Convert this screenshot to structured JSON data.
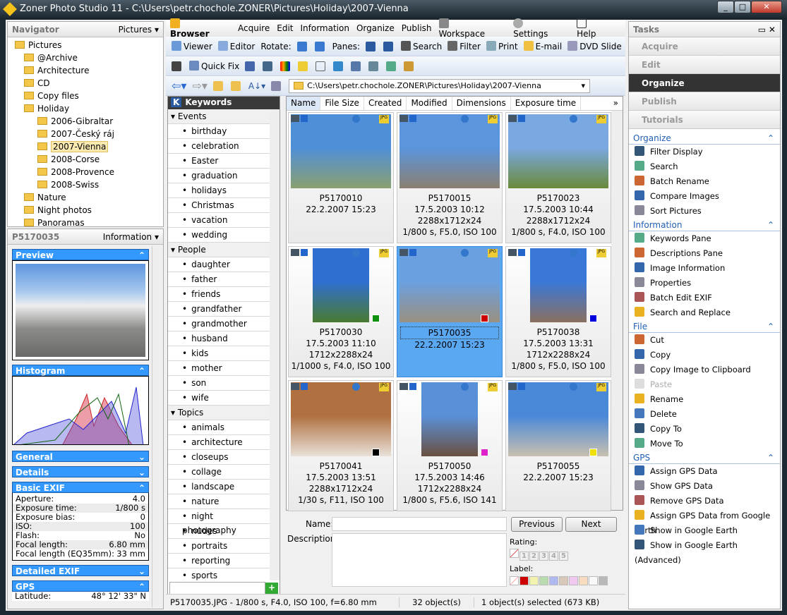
{
  "window": {
    "title": "Zoner Photo Studio 11 - C:\\Users\\petr.chochole.ZONER\\Pictures\\Holiday\\2007-Vienna"
  },
  "navigator": {
    "title": "Navigator",
    "mode": "Pictures",
    "tree": [
      {
        "label": "Pictures",
        "level": 0
      },
      {
        "label": "@Archive",
        "level": 1
      },
      {
        "label": "Architecture",
        "level": 1
      },
      {
        "label": "CD",
        "level": 1
      },
      {
        "label": "Copy files",
        "level": 1
      },
      {
        "label": "Holiday",
        "level": 1
      },
      {
        "label": "2006-Gibraltar",
        "level": 2
      },
      {
        "label": "2007-Český ráj",
        "level": 2
      },
      {
        "label": "2007-Vienna",
        "level": 2,
        "selected": true
      },
      {
        "label": "2008-Corse",
        "level": 2
      },
      {
        "label": "2008-Provence",
        "level": 2
      },
      {
        "label": "2008-Swiss",
        "level": 2
      },
      {
        "label": "Nature",
        "level": 1
      },
      {
        "label": "Night photos",
        "level": 1
      },
      {
        "label": "Panoramas",
        "level": 1
      }
    ]
  },
  "info": {
    "file": "P5170035",
    "mode": "Information",
    "sections": {
      "preview": "Preview",
      "histogram": "Histogram",
      "general": "General",
      "details": "Details",
      "basic_exif": "Basic EXIF",
      "detailed_exif": "Detailed EXIF",
      "gps": "GPS"
    },
    "exif": [
      [
        "Aperture:",
        "4.0"
      ],
      [
        "Exposure time:",
        "1/800 s"
      ],
      [
        "Exposure bias:",
        "0"
      ],
      [
        "ISO:",
        "100"
      ],
      [
        "Flash:",
        "No"
      ],
      [
        "Focal length:",
        "6.80 mm"
      ],
      [
        "Focal length (EQ35mm):",
        "33 mm"
      ]
    ],
    "gps": [
      [
        "Latitude:",
        "48° 12' 33\" N"
      ]
    ]
  },
  "menu": {
    "browser": "Browser",
    "items": [
      "Acquire",
      "Edit",
      "Information",
      "Organize",
      "Publish"
    ],
    "workspace": "Workspace",
    "settings": "Settings",
    "help": "Help"
  },
  "toolbar1": {
    "viewer": "Viewer",
    "editor": "Editor",
    "rotate": "Rotate:",
    "panes": "Panes:",
    "search": "Search",
    "filter": "Filter",
    "print": "Print",
    "email": "E-mail",
    "dvd": "DVD Slide"
  },
  "toolbar2": {
    "quickfix": "Quick Fix"
  },
  "path": "C:\\Users\\petr.chochole.ZONER\\Pictures\\Holiday\\2007-Vienna",
  "keywords": {
    "title": "Keywords",
    "groups": [
      {
        "name": "Events",
        "items": [
          "birthday",
          "celebration",
          "Easter",
          "graduation",
          "holidays",
          "Christmas",
          "vacation",
          "wedding"
        ]
      },
      {
        "name": "People",
        "items": [
          "daughter",
          "father",
          "friends",
          "grandfather",
          "grandmother",
          "husband",
          "kids",
          "mother",
          "son",
          "wife"
        ]
      },
      {
        "name": "Topics",
        "items": [
          "animals",
          "architecture",
          "closeups",
          "collage",
          "landscape",
          "nature",
          "night photography",
          "nudes",
          "portraits",
          "reporting",
          "sports"
        ]
      }
    ]
  },
  "columns": [
    "Name",
    "File Size",
    "Created",
    "Modified",
    "Dimensions",
    "Exposure time"
  ],
  "thumbs": [
    {
      "name": "P5170010",
      "l2": "22.2.2007 15:23",
      "l3": "",
      "l4": "",
      "c1": "#4f8fd8",
      "c2": "#8aa070"
    },
    {
      "name": "P5170015",
      "l2": "17.5.2003 10:12",
      "l3": "2288x1712x24",
      "l4": "1/800 s, F5.0, ISO 100",
      "c1": "#5b95dd",
      "c2": "#8a8070"
    },
    {
      "name": "P5170023",
      "l2": "17.5.2003 10:44",
      "l3": "2288x1712x24",
      "l4": "1/800 s, F4.0, ISO 100",
      "c1": "#7aa8e0",
      "c2": "#6a8a3a"
    },
    {
      "name": "P5170030",
      "l2": "17.5.2003 11:10",
      "l3": "1712x2288x24",
      "l4": "1/1000 s, F4.0, ISO 100",
      "c1": "#2f6fd0",
      "c2": "#4a7a30",
      "label": "#109010"
    },
    {
      "name": "P5170035",
      "l2": "22.2.2007 15:23",
      "l3": "",
      "l4": "",
      "c1": "#6aa0e0",
      "c2": "#9a9080",
      "label": "#cc0000",
      "selected": true
    },
    {
      "name": "P5170038",
      "l2": "17.5.2003 13:31",
      "l3": "1712x2288x24",
      "l4": "1/800 s, F5.0, ISO 100",
      "c1": "#3a78d8",
      "c2": "#8a7060",
      "label": "#0000dd"
    },
    {
      "name": "P5170041",
      "l2": "17.5.2003 13:51",
      "l3": "2288x1712x24",
      "l4": "1/30 s, F11, ISO 100",
      "c1": "#b07040",
      "c2": "#e8e0d8",
      "label": "#000000"
    },
    {
      "name": "P5170050",
      "l2": "17.5.2003 14:46",
      "l3": "1712x2288x24",
      "l4": "1/800 s, F5.6, ISO 141",
      "c1": "#5a90d8",
      "c2": "#6a5040",
      "label": "#dd22cc"
    },
    {
      "name": "P5170055",
      "l2": "22.2.2007 15:23",
      "l3": "",
      "l4": "",
      "c1": "#4a88d8",
      "c2": "#c8c0b0",
      "label": "#f0e000"
    }
  ],
  "editor": {
    "name_label": "Name:",
    "desc_label": "Description:",
    "prev": "Previous",
    "next": "Next",
    "rating_label": "Rating:",
    "ratings": [
      "1",
      "2",
      "3",
      "4",
      "5"
    ],
    "label_label": "Label:",
    "label_colors": [
      "#cc0000",
      "#f3f3b0",
      "#b8dcb0",
      "#b0b8f0",
      "#d8c8b8",
      "#f0c8f0",
      "#f8dcc0",
      "#f8f8f8",
      "#b8b8b8"
    ]
  },
  "status": {
    "file": "P5170035.JPG - 1/800 s, F4.0, ISO 100, f=6.80 mm",
    "count": "32 object(s)",
    "selected": "1 object(s) selected (673 KB)"
  },
  "tasks": {
    "title": "Tasks",
    "sections": [
      "Acquire",
      "Edit",
      "Organize",
      "Publish",
      "Tutorials"
    ],
    "active": "Organize",
    "groups": [
      {
        "name": "Organize",
        "items": [
          "Filter Display",
          "Search",
          "Batch Rename",
          "Compare Images",
          "Sort Pictures"
        ]
      },
      {
        "name": "Information",
        "items": [
          "Keywords Pane",
          "Descriptions Pane",
          "Image Information",
          "Properties",
          "Batch Edit EXIF",
          "Search and Replace"
        ]
      },
      {
        "name": "File",
        "items": [
          "Cut",
          "Copy",
          "Copy Image to Clipboard",
          "Paste",
          "Rename",
          "Delete",
          "Copy To",
          "Move To"
        ],
        "disabled": [
          "Paste"
        ]
      },
      {
        "name": "GPS",
        "items": [
          "Assign GPS Data",
          "Show GPS Data",
          "Remove GPS Data",
          "Assign GPS Data from Google Earth",
          "Show in Google Earth",
          "Show in Google Earth (Advanced)"
        ]
      }
    ]
  }
}
